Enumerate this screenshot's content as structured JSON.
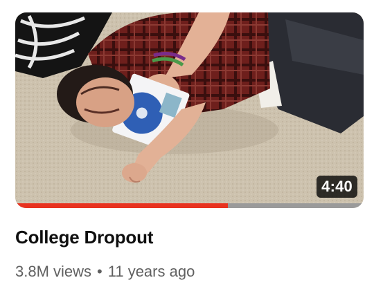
{
  "video": {
    "duration": "4:40",
    "title": "College Dropout",
    "views": "3.8M views",
    "separator": "•",
    "age": "11 years ago",
    "watch_progress": 0.61,
    "thumbnail_icon": "person-lying-on-carpet-thumbnail"
  },
  "colors": {
    "progress_watched": "#e8321f",
    "progress_remaining": "#9a9a9a",
    "duration_badge_bg": "#000000",
    "title_text": "#0f0f0f",
    "meta_text": "#606060"
  }
}
